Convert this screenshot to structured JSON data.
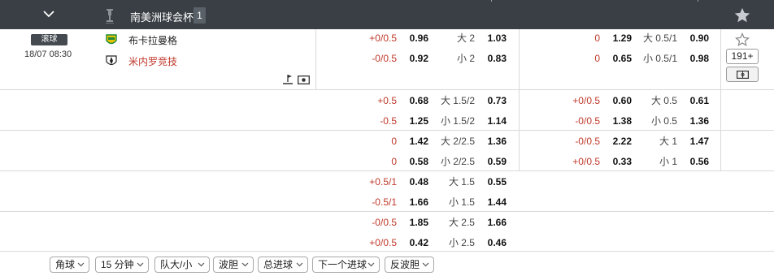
{
  "header": {
    "league_name": "南美洲球会杯",
    "match_count": "1"
  },
  "match": {
    "status_badge": "滚球",
    "kickoff": "18/07 08:30",
    "home_team": "布卡拉曼格",
    "away_team": "米内罗竞技",
    "more_markets": "191+"
  },
  "odds_rows": [
    {
      "ft_hdp_h": "+0/0.5",
      "ft_hdp_h_odds": "0.96",
      "ft_ou_over": "大 2",
      "ft_ou_over_odds": "1.03",
      "ht_hdp_h": "0",
      "ht_hdp_h_odds": "1.29",
      "ht_ou_over": "大 0.5/1",
      "ht_ou_over_odds": "0.90"
    },
    {
      "ft_hdp_h": "-0/0.5",
      "ft_hdp_h_odds": "0.92",
      "ft_ou_over": "小 2",
      "ft_ou_over_odds": "0.83",
      "ht_hdp_h": "0",
      "ht_hdp_h_odds": "0.65",
      "ht_ou_over": "小 0.5/1",
      "ht_ou_over_odds": "0.98"
    },
    {
      "ft_hdp_h": "+0.5",
      "ft_hdp_h_odds": "0.68",
      "ft_ou_over": "大 1.5/2",
      "ft_ou_over_odds": "0.73",
      "ht_hdp_h": "+0/0.5",
      "ht_hdp_h_odds": "0.60",
      "ht_ou_over": "大 0.5",
      "ht_ou_over_odds": "0.61"
    },
    {
      "ft_hdp_h": "-0.5",
      "ft_hdp_h_odds": "1.25",
      "ft_ou_over": "小 1.5/2",
      "ft_ou_over_odds": "1.14",
      "ht_hdp_h": "-0/0.5",
      "ht_hdp_h_odds": "1.38",
      "ht_ou_over": "小 0.5",
      "ht_ou_over_odds": "1.36"
    },
    {
      "ft_hdp_h": "0",
      "ft_hdp_h_odds": "1.42",
      "ft_ou_over": "大 2/2.5",
      "ft_ou_over_odds": "1.36",
      "ht_hdp_h": "-0/0.5",
      "ht_hdp_h_odds": "2.22",
      "ht_ou_over": "大 1",
      "ht_ou_over_odds": "1.47"
    },
    {
      "ft_hdp_h": "0",
      "ft_hdp_h_odds": "0.58",
      "ft_ou_over": "小 2/2.5",
      "ft_ou_over_odds": "0.59",
      "ht_hdp_h": "+0/0.5",
      "ht_hdp_h_odds": "0.33",
      "ht_ou_over": "小 1",
      "ht_ou_over_odds": "0.56"
    },
    {
      "ft_hdp_h": "+0.5/1",
      "ft_hdp_h_odds": "0.48",
      "ft_ou_over": "大 1.5",
      "ft_ou_over_odds": "0.55",
      "ht_hdp_h": "",
      "ht_hdp_h_odds": "",
      "ht_ou_over": "",
      "ht_ou_over_odds": ""
    },
    {
      "ft_hdp_h": "-0.5/1",
      "ft_hdp_h_odds": "1.66",
      "ft_ou_over": "小 1.5",
      "ft_ou_over_odds": "1.44",
      "ht_hdp_h": "",
      "ht_hdp_h_odds": "",
      "ht_ou_over": "",
      "ht_ou_over_odds": ""
    },
    {
      "ft_hdp_h": "-0/0.5",
      "ft_hdp_h_odds": "1.85",
      "ft_ou_over": "大 2.5",
      "ft_ou_over_odds": "1.66",
      "ht_hdp_h": "",
      "ht_hdp_h_odds": "",
      "ht_ou_over": "",
      "ht_ou_over_odds": ""
    },
    {
      "ft_hdp_h": "+0/0.5",
      "ft_hdp_h_odds": "0.42",
      "ft_ou_over": "小 2.5",
      "ft_ou_over_odds": "0.46",
      "ht_hdp_h": "",
      "ht_hdp_h_odds": "",
      "ht_ou_over": "",
      "ht_ou_over_odds": ""
    }
  ],
  "filters": [
    {
      "label": "角球"
    },
    {
      "label": "15 分钟"
    },
    {
      "label": "队大/小"
    },
    {
      "label": "波胆"
    },
    {
      "label": "总进球"
    },
    {
      "label": "下一个进球"
    },
    {
      "label": "反波胆"
    }
  ],
  "colors": {
    "header_bg": "#3a3f45",
    "handicap_red": "#c0392b",
    "away_team_red": "#c0392b",
    "home_icon_yellow": "#e6c300",
    "home_icon_green": "#1e8a3a"
  },
  "icons": {
    "header_toggle": "chevron-down-icon",
    "league": "trophy-icon",
    "favorite": "star-icon",
    "pitch": "pitch-icon",
    "video": "video-icon"
  }
}
